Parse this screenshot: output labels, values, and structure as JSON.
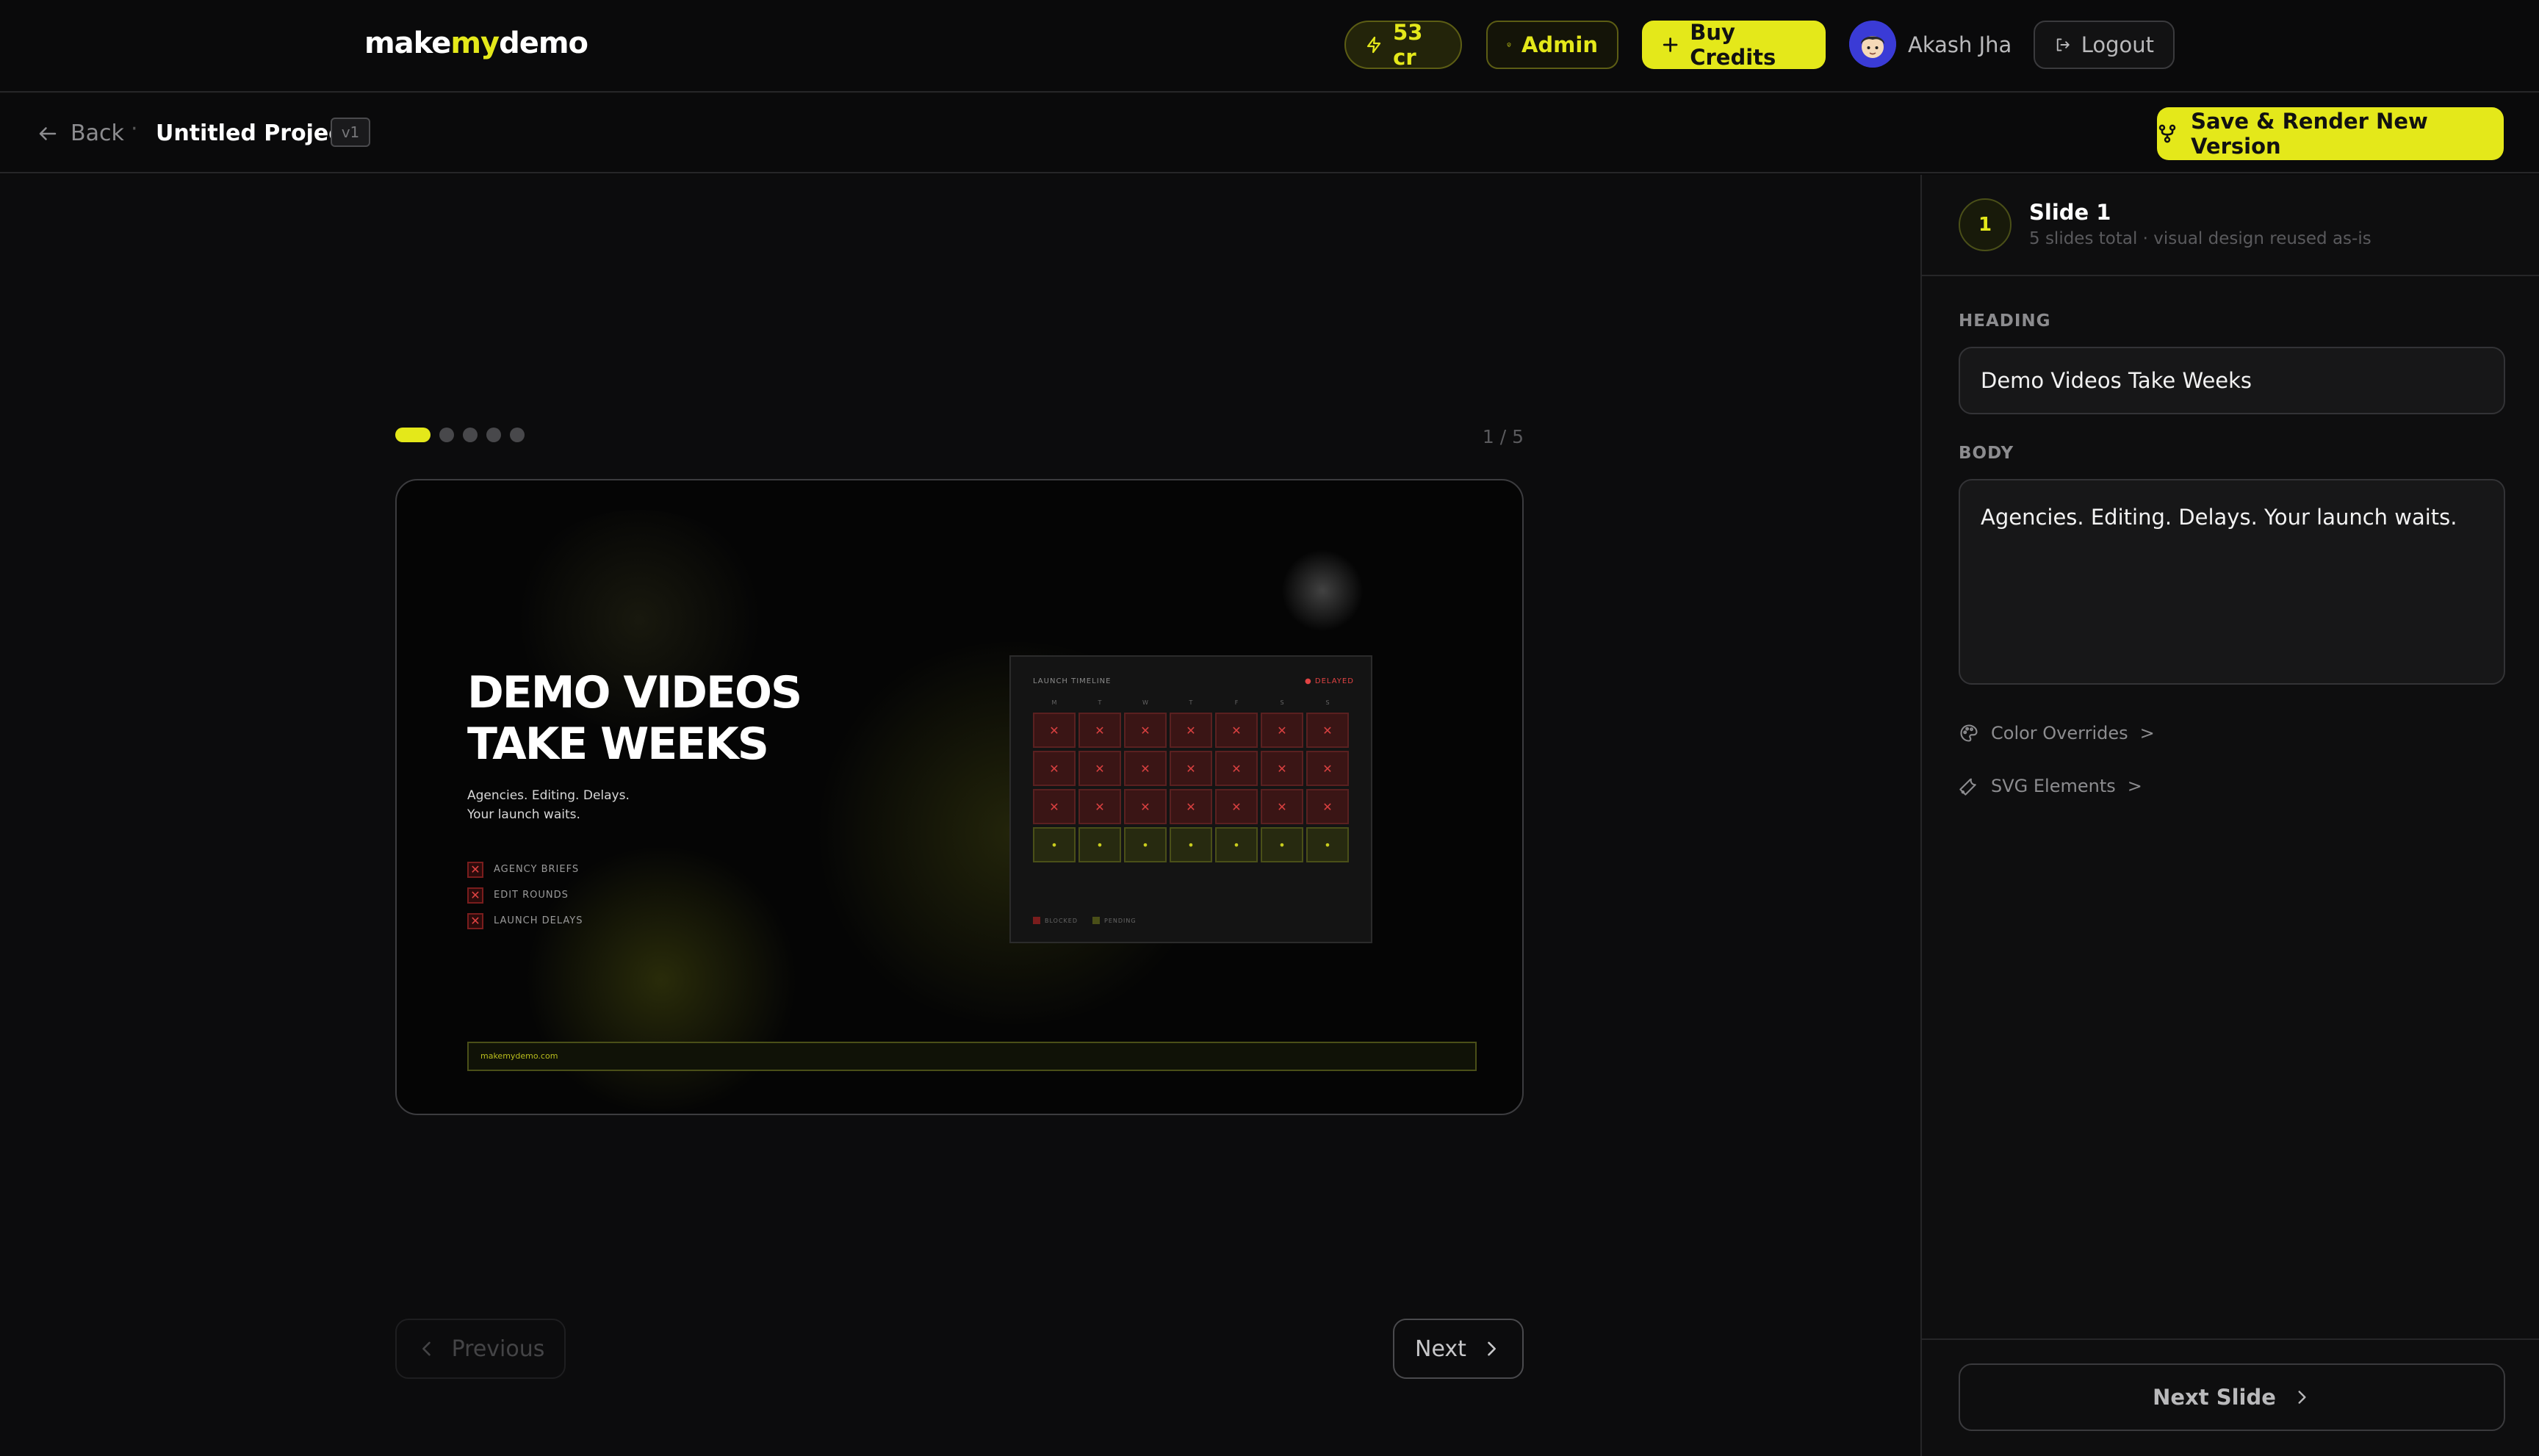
{
  "header": {
    "logo_prefix": "make",
    "logo_accent": "my",
    "logo_suffix": "demo",
    "credits": "53 cr",
    "admin": "Admin",
    "buy_credits": "Buy Credits",
    "user_name": "Akash Jha",
    "logout": "Logout"
  },
  "subbar": {
    "back": "Back",
    "separator": "·",
    "project_title": "Untitled Project",
    "version": "v1",
    "save_render": "Save & Render New Version"
  },
  "slideshow": {
    "current": 1,
    "total": 5,
    "counter": "1 / 5",
    "previous": "Previous",
    "next": "Next"
  },
  "slide": {
    "heading_line1": "DEMO VIDEOS",
    "heading_line2": "TAKE WEEKS",
    "body_line1": "Agencies. Editing. Delays.",
    "body_line2": "Your launch waits.",
    "checklist": [
      "AGENCY BRIEFS",
      "EDIT ROUNDS",
      "LAUNCH DELAYS"
    ],
    "timeline": {
      "title": "LAUNCH TIMELINE",
      "status": "● DELAYED",
      "days": [
        "M",
        "T",
        "W",
        "T",
        "F",
        "S",
        "S"
      ],
      "legend_blocked": "BLOCKED",
      "legend_pending": "PENDING"
    },
    "url": "makemydemo.com"
  },
  "panel": {
    "slide_number": "1",
    "slide_name": "Slide 1",
    "slide_subtitle": "5 slides total · visual design reused as-is",
    "heading_label": "HEADING",
    "heading_value": "Demo Videos Take Weeks",
    "body_label": "BODY",
    "body_value": "Agencies. Editing. Delays. Your launch waits.",
    "color_overrides": "Color Overrides",
    "svg_elements": "SVG Elements",
    "chevron": ">",
    "next_slide": "Next Slide"
  },
  "colors": {
    "accent": "#e4e81a",
    "danger": "#e14343",
    "background": "#0b0b0c"
  },
  "icons": {
    "credits": "lightning-icon",
    "admin": "shield-icon",
    "buy": "plus-icon",
    "logout": "logout-icon",
    "back": "arrow-left-icon",
    "save": "branch-icon",
    "color": "palette-icon",
    "svg": "wrench-icon"
  }
}
